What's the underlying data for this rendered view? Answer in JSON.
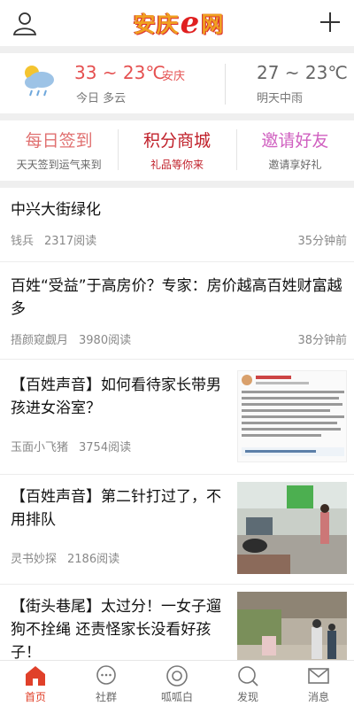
{
  "header": {
    "logo_main": "安庆",
    "logo_e": "e",
    "logo_end": "网",
    "user_icon": "user-icon",
    "add_icon": "plus-icon"
  },
  "weather": {
    "icon": "cloud-rain-sun-icon",
    "today_temp": "33 ~ 23℃",
    "city": "安庆",
    "today_desc": "今日 多云",
    "tomorrow_temp": "27 ~ 23℃",
    "tomorrow_desc": "明天中雨"
  },
  "actions": [
    {
      "title": "每日签到",
      "sub": "天天签到运气来到",
      "color": "#e07070"
    },
    {
      "title": "积分商城",
      "sub": "礼品等你来",
      "color": "#c0202a"
    },
    {
      "title": "邀请好友",
      "sub": "邀请享好礼",
      "color": "#d060c0"
    }
  ],
  "feed": [
    {
      "title": "中兴大街绿化",
      "author": "钱兵",
      "reads": "2317阅读",
      "time": "35分钟前"
    },
    {
      "title": "百姓“受益”于高房价？专家：房价越高百姓财富越多",
      "author": "捂颜窥觑月",
      "reads": "3980阅读",
      "time": "38分钟前"
    },
    {
      "title": "【百姓声音】如何看待家长带男孩进女浴室？",
      "author": "玉面小飞猪",
      "reads": "3754阅读",
      "thumb": "social-post-screenshot"
    },
    {
      "title": "【百姓声音】第二针打过了，不用排队",
      "author": "灵书妙探",
      "reads": "2186阅读",
      "thumb": "vaccination-hall-photo"
    },
    {
      "title": "【街头巷尾】太过分！一女子遛狗不拴绳 还责怪家长没看好孩子！",
      "author": "",
      "reads": "",
      "thumb": "street-scene-photo"
    }
  ],
  "nav": [
    {
      "label": "首页",
      "icon": "home-icon",
      "active": true
    },
    {
      "label": "社群",
      "icon": "chat-bubble-icon",
      "active": false
    },
    {
      "label": "呱呱白",
      "icon": "circle-target-icon",
      "active": false
    },
    {
      "label": "发现",
      "icon": "search-icon",
      "active": false
    },
    {
      "label": "消息",
      "icon": "mail-icon",
      "active": false
    }
  ]
}
